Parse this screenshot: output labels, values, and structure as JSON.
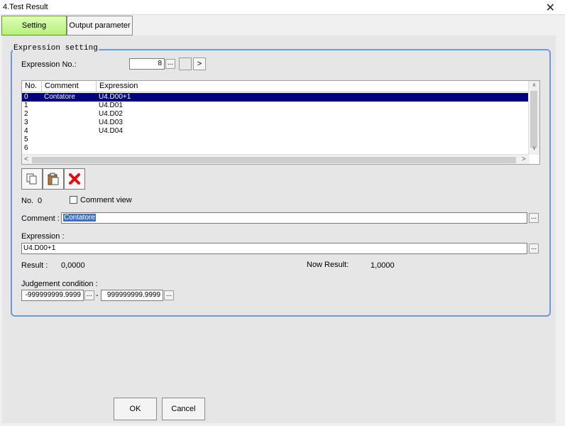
{
  "window": {
    "title": "4.Test Result",
    "close_glyph": "✕"
  },
  "tabs": [
    {
      "label": "Setting"
    },
    {
      "label": "Output parameter"
    }
  ],
  "group": {
    "legend": "Expression setting"
  },
  "expression_no": {
    "label": "Expression No.:",
    "value": "8",
    "dots": "...",
    "prev": "",
    "next": ">"
  },
  "list": {
    "headers": [
      "No.",
      "Comment",
      "Expression"
    ],
    "rows": [
      {
        "no": "0",
        "comment": "Contatore",
        "expr": "U4.D00+1"
      },
      {
        "no": "1",
        "comment": "",
        "expr": "U4.D01"
      },
      {
        "no": "2",
        "comment": "",
        "expr": "U4.D02"
      },
      {
        "no": "3",
        "comment": "",
        "expr": "U4.D03"
      },
      {
        "no": "4",
        "comment": "",
        "expr": "U4.D04"
      },
      {
        "no": "5",
        "comment": "",
        "expr": ""
      },
      {
        "no": "6",
        "comment": "",
        "expr": ""
      }
    ],
    "scroll_up": "∧",
    "scroll_down": "∨",
    "scroll_left": "<",
    "scroll_right": ">"
  },
  "toolbar": {
    "icons": [
      "copy-icon",
      "paste-icon",
      "delete-icon"
    ],
    "delete_color": "#e01010"
  },
  "selected": {
    "no_label": "No.",
    "no_value": "0",
    "comment_view_label": "Comment view"
  },
  "comment": {
    "label": "Comment :",
    "value": "Contatore",
    "dots": "..."
  },
  "expression": {
    "label": "Expression :",
    "value": "U4.D00+1",
    "dots": "..."
  },
  "result": {
    "label": "Result :",
    "value": "0,0000",
    "now_label": "Now Result:",
    "now_value": "1,0000"
  },
  "judgement": {
    "label": "Judgement condition :",
    "min": "-999999999.9999",
    "max": "999999999.9999",
    "separator": "-",
    "dots": "..."
  },
  "buttons": {
    "ok": "OK",
    "cancel": "Cancel"
  },
  "colors": {
    "accent_border": "#6f9ad8",
    "tab_active": "#c8f590",
    "selection": "#000080"
  }
}
